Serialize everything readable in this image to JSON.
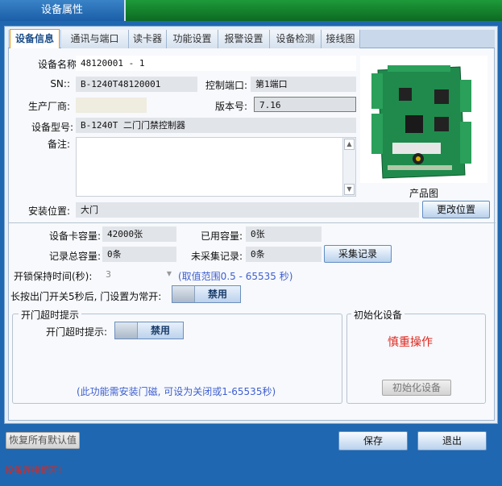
{
  "window": {
    "title": "设备属性"
  },
  "tabs": [
    "设备信息",
    "通讯与端口",
    "读卡器",
    "功能设置",
    "报警设置",
    "设备检测",
    "接线图"
  ],
  "device": {
    "name_label": "设备名称:",
    "name_value": "48120001 - 1",
    "sn_label": "SN::",
    "sn_value": "B-1240T48120001",
    "port_label": "控制端口:",
    "port_value": "第1端口",
    "maker_label": "生产厂商:",
    "maker_value": "",
    "version_label": "版本号:",
    "version_value": "7.16",
    "model_label": "设备型号:",
    "model_value": "B-1240T 二门门禁控制器",
    "remark_label": "备注:",
    "remark_value": "",
    "image_caption": "产品图",
    "location_label": "安装位置:",
    "location_value": "大门",
    "change_location_button": "更改位置"
  },
  "capacity": {
    "card_cap_label": "设备卡容量:",
    "card_cap_value": "42000张",
    "used_cap_label": "已用容量:",
    "used_cap_value": "0张",
    "record_total_label": "记录总容量:",
    "record_total_value": "0条",
    "unsampled_label": "未采集记录:",
    "unsampled_value": "0条",
    "collect_button": "采集记录"
  },
  "unlock": {
    "hold_label": "开锁保持时间(秒):",
    "hold_value": "3",
    "hold_range": "(取值范围0.5 - 65535 秒)",
    "long_press_label": "长按出门开关5秒后, 门设置为常开:",
    "long_press_toggle": "禁用"
  },
  "timeout_group": {
    "title": "开门超时提示",
    "label": "开门超时提示:",
    "toggle": "禁用",
    "note": "(此功能需安装门磁, 可设为关闭或1-65535秒)"
  },
  "init_group": {
    "title": "初始化设备",
    "warning": "慎重操作",
    "button": "初始化设备"
  },
  "footer": {
    "restore_button": "恢复所有默认值",
    "save_button": "保存",
    "exit_button": "退出"
  },
  "status": {
    "text": "设备连接断开!"
  },
  "colors": {
    "accent": "#1f67b0",
    "title_green": "#0c6a22",
    "warning_red": "#e0261d",
    "hint_blue": "#3f5fd0",
    "tab_active_border": "#e79a1e"
  }
}
